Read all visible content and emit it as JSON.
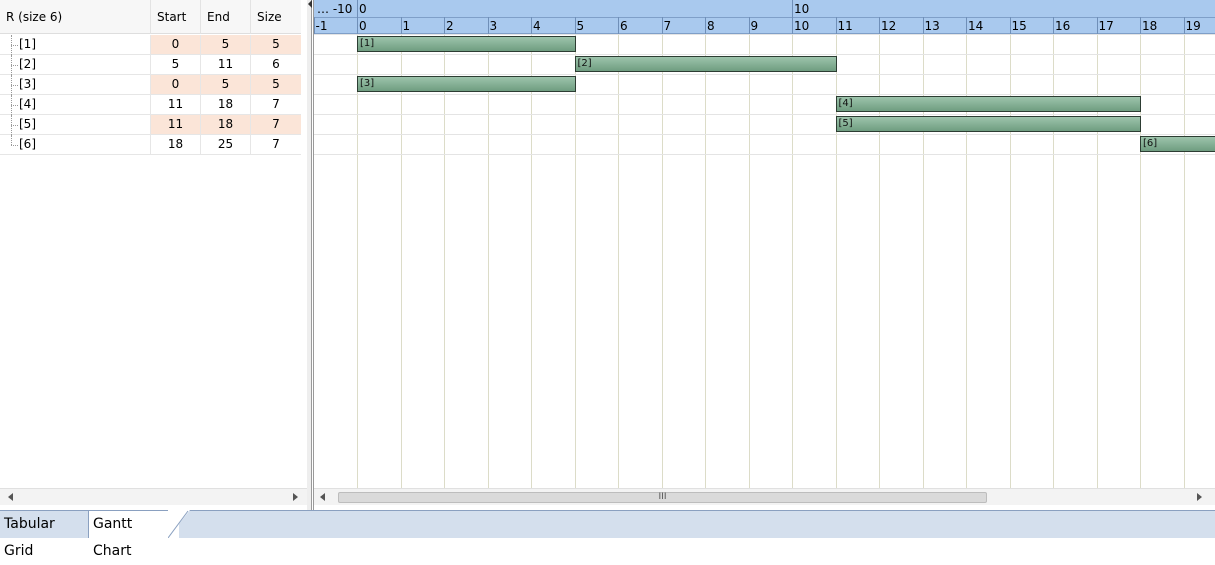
{
  "grid": {
    "headers": {
      "r": "R  (size 6)",
      "start": "Start",
      "end": "End",
      "size": "Size"
    },
    "rows": [
      {
        "label": "[1]",
        "start": "0",
        "end": "5",
        "size": "5",
        "hl": true
      },
      {
        "label": "[2]",
        "start": "5",
        "end": "11",
        "size": "6",
        "hl": false
      },
      {
        "label": "[3]",
        "start": "0",
        "end": "5",
        "size": "5",
        "hl": true
      },
      {
        "label": "[4]",
        "start": "11",
        "end": "18",
        "size": "7",
        "hl": false
      },
      {
        "label": "[5]",
        "start": "11",
        "end": "18",
        "size": "7",
        "hl": true
      },
      {
        "label": "[6]",
        "start": "18",
        "end": "25",
        "size": "7",
        "hl": false
      }
    ]
  },
  "gantt": {
    "scale_major": [
      {
        "label": "… -10",
        "value": -10
      },
      {
        "label": "0",
        "value": 0
      },
      {
        "label": "10",
        "value": 10
      }
    ],
    "scale_minor": [
      "-1",
      "0",
      "1",
      "2",
      "3",
      "4",
      "5",
      "6",
      "7",
      "8",
      "9",
      "10",
      "11",
      "12",
      "13",
      "14",
      "15",
      "16",
      "17",
      "18",
      "19"
    ],
    "bars": [
      {
        "label": "[1]",
        "start": 0,
        "end": 5
      },
      {
        "label": "[2]",
        "start": 5,
        "end": 11
      },
      {
        "label": "[3]",
        "start": 0,
        "end": 5
      },
      {
        "label": "[4]",
        "start": 11,
        "end": 18
      },
      {
        "label": "[5]",
        "start": 11,
        "end": 18
      },
      {
        "label": "[6]",
        "start": 18,
        "end": 25
      }
    ],
    "scroll_thumb_glyph": "III"
  },
  "tabs": [
    {
      "label": "Tabular Grid",
      "active": false
    },
    {
      "label": "Gantt Chart",
      "active": true
    }
  ],
  "colors": {
    "scale_bg": "#a9c9ee",
    "bar_fill": "#86b096",
    "highlight_cell": "#fbe5d8",
    "tabbar_bg": "#d4dfed"
  }
}
